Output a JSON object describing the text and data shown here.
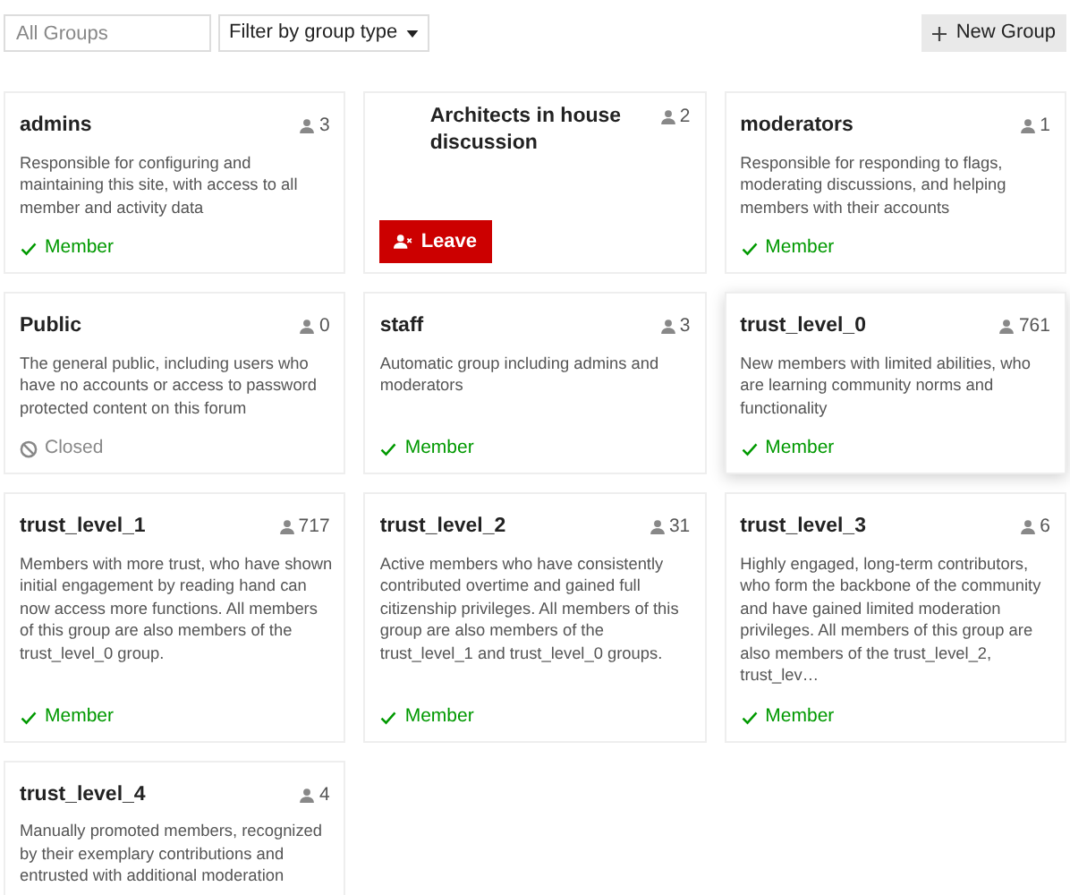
{
  "search": {
    "placeholder": "All Groups"
  },
  "filter": {
    "label": "Filter by group type"
  },
  "new_group": {
    "label": "New Group"
  },
  "groups": [
    {
      "name": "admins",
      "count": "3",
      "description": "Responsible for configuring and maintaining this site, with access to all member and activity data",
      "status": {
        "kind": "member",
        "label": "Member"
      },
      "flair": false,
      "highlighted": false
    },
    {
      "name": "Architects in house discussion",
      "count": "2",
      "status": {
        "kind": "leave",
        "label": "Leave"
      },
      "flair": true,
      "highlighted": false
    },
    {
      "name": "moderators",
      "count": "1",
      "description": "Responsible for responding to flags, moderating discussions, and helping members with their accounts",
      "status": {
        "kind": "member",
        "label": "Member"
      },
      "flair": false,
      "highlighted": false
    },
    {
      "name": "Public",
      "count": "0",
      "description": "The general public, including users who have no accounts or access to password protected content on this forum",
      "status": {
        "kind": "closed",
        "label": "Closed"
      },
      "flair": false,
      "highlighted": false
    },
    {
      "name": "staff",
      "count": "3",
      "description": "Automatic group including admins and moderators",
      "status": {
        "kind": "member",
        "label": "Member"
      },
      "flair": false,
      "highlighted": false
    },
    {
      "name": "trust_level_0",
      "count": "761",
      "description": "New members with limited abilities, who are learning community norms and functionality",
      "status": {
        "kind": "member",
        "label": "Member"
      },
      "flair": false,
      "highlighted": true
    },
    {
      "name": "trust_level_1",
      "count": "717",
      "description": "Members with more trust, who have shown initial engagement by reading hand can now access more functions. All members of this group are also members of the trust_level_0 group.",
      "status": {
        "kind": "member",
        "label": "Member"
      },
      "flair": false,
      "highlighted": false
    },
    {
      "name": "trust_level_2",
      "count": "31",
      "description": "Active members who have consistently contributed overtime and gained full citizenship privileges. All members of this group are also members of the trust_level_1 and trust_level_0 groups.",
      "status": {
        "kind": "member",
        "label": "Member"
      },
      "flair": false,
      "highlighted": false
    },
    {
      "name": "trust_level_3",
      "count": "6",
      "description": "Highly engaged, long-term contributors, who form the backbone of the community and have gained limited moderation privileges. All members of this group are also members of the trust_level_2, trust_lev…",
      "status": {
        "kind": "member",
        "label": "Member"
      },
      "flair": false,
      "highlighted": false
    },
    {
      "name": "trust_level_4",
      "count": "4",
      "description": "Manually promoted members, recognized by their exemplary contributions and entrusted with additional moderation",
      "flair": false,
      "highlighted": false
    }
  ]
}
